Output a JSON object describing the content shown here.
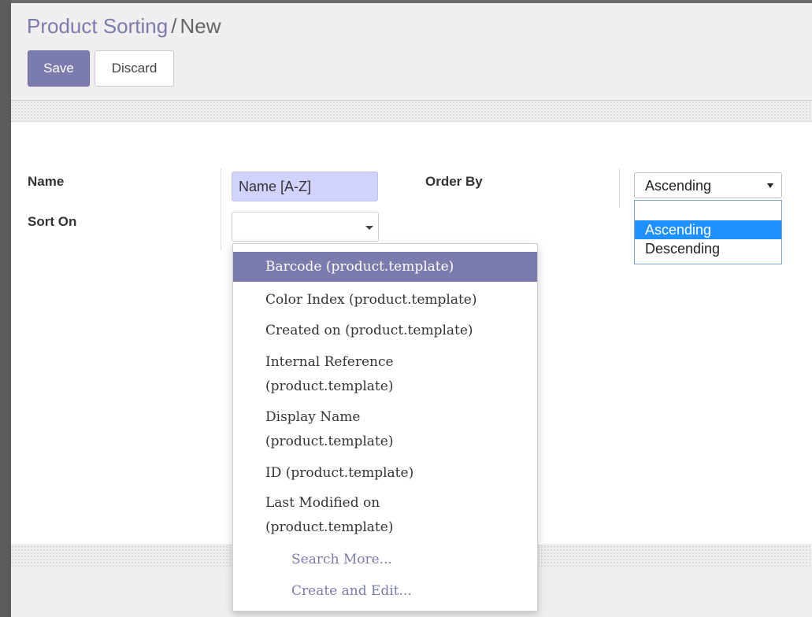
{
  "breadcrumb": {
    "parent": "Product Sorting",
    "separator": "/",
    "current": "New"
  },
  "buttons": {
    "save": "Save",
    "discard": "Discard"
  },
  "form": {
    "name_label": "Name",
    "name_value": "Name [A-Z]",
    "sort_on_label": "Sort On",
    "sort_on_value": "",
    "order_by_label": "Order By",
    "order_by_value": "Ascending"
  },
  "sort_on_dropdown": {
    "items": [
      {
        "label": "Barcode (product.template)",
        "active": true
      },
      {
        "label": "Color Index (product.template)"
      },
      {
        "label": "Created on (product.template)"
      },
      {
        "label": "Internal Reference (product.template)"
      },
      {
        "label": "Display Name (product.template)"
      },
      {
        "label": "ID (product.template)"
      },
      {
        "label": "Last Modified on (product.template)"
      }
    ],
    "search_more": "Search More...",
    "create_and_edit": "Create and Edit..."
  },
  "order_by_options": [
    "",
    "Ascending",
    "Descending"
  ],
  "colors": {
    "accent": "#7c7bad",
    "name_field_bg": "#d2d2ff",
    "select_highlight": "#1e90ff"
  }
}
